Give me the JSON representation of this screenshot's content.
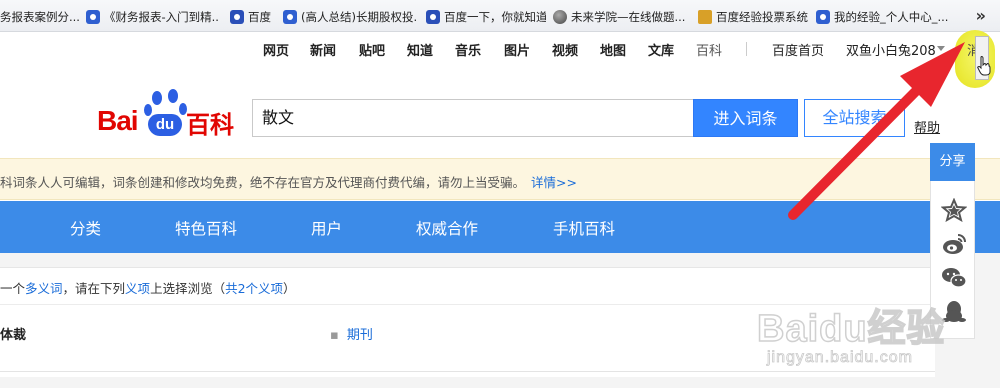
{
  "bookmarks": {
    "items": [
      {
        "label": "务报表案例分...",
        "icon": "paw-icon"
      },
      {
        "label": "《财务报表-入门到精...",
        "icon": "paw-icon"
      },
      {
        "label": "百度",
        "icon": "paw-square-icon"
      },
      {
        "label": "(高人总结)长期股权投...",
        "icon": "paw-icon"
      },
      {
        "label": "百度一下，你就知道",
        "icon": "paw-square-icon"
      },
      {
        "label": "未来学院—在线做题...",
        "icon": "globe-icon"
      },
      {
        "label": "百度经验投票系统",
        "icon": "box-icon"
      },
      {
        "label": "我的经验_个人中心_...",
        "icon": "paw-icon"
      }
    ],
    "overflow": "»"
  },
  "topnav": {
    "items": [
      "网页",
      "新闻",
      "贴吧",
      "知道",
      "音乐",
      "图片",
      "视频",
      "地图",
      "文库",
      "百科"
    ],
    "home": "百度首页",
    "user": "双鱼小白兔208",
    "side_button": "消"
  },
  "logo": {
    "bai": "Bai",
    "du": "du",
    "cn": "百科"
  },
  "search": {
    "value": "散文",
    "enter_label": "进入词条",
    "site_label": "全站搜索",
    "help_label": "帮助"
  },
  "notice": {
    "text": "科词条人人可编辑，词条创建和修改均免费，绝不存在官方及代理商付费代编，请勿上当受骗。",
    "link": "详情>>"
  },
  "bluenav": {
    "items": [
      "分类",
      "特色百科",
      "用户",
      "权威合作",
      "手机百科"
    ]
  },
  "content": {
    "poly_prefix": "一个",
    "poly_link1": "多义词",
    "poly_mid": "，请在下列",
    "poly_link2": "义项",
    "poly_mid2": "上选择浏览（",
    "poly_link3": "共2个义项",
    "poly_suffix": "）",
    "row_left": "体裁",
    "row_right_dot": "▪",
    "row_right": "期刊"
  },
  "share": {
    "title": "分享",
    "icons": [
      "star-icon",
      "weibo-icon",
      "wechat-icon",
      "qq-icon"
    ]
  },
  "watermark": {
    "big": "Baidu经验",
    "small": "jingyan.baidu.com"
  },
  "colors": {
    "accent": "#3c8be8",
    "brand_red": "#e10602",
    "arrow": "#e8262e",
    "notice_bg": "#fdf6e0"
  }
}
